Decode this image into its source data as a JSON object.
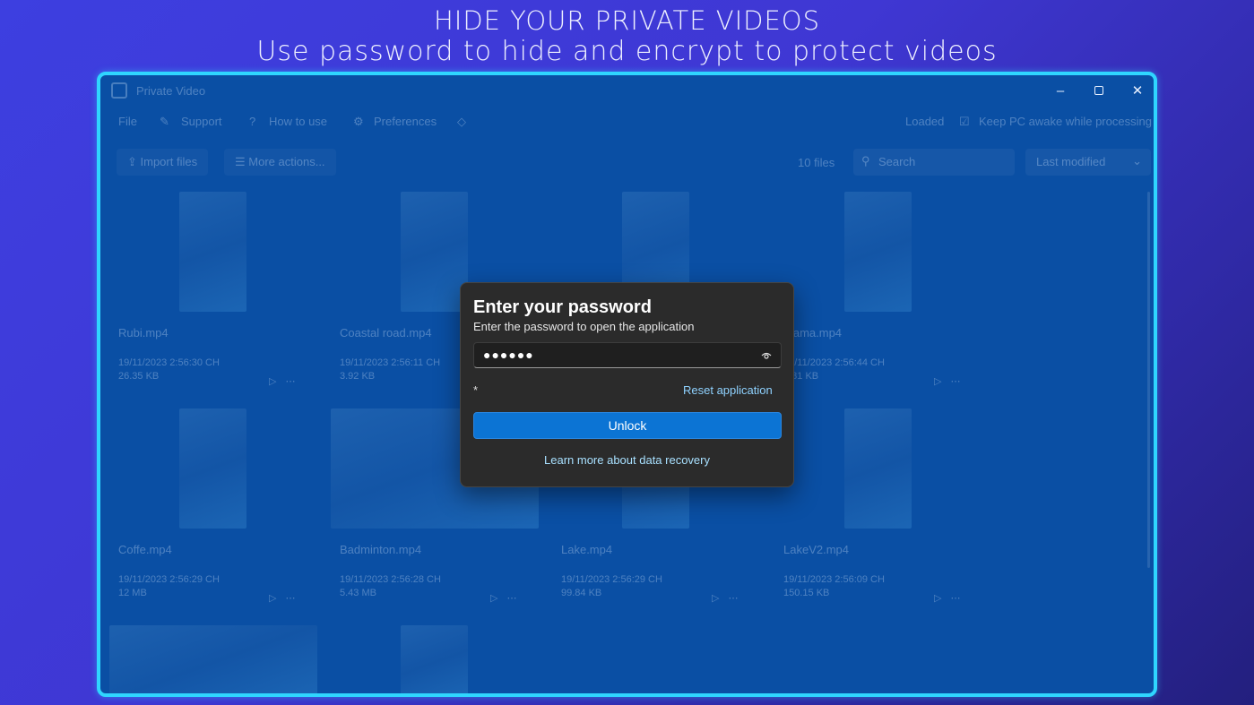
{
  "headline": {
    "line1": "HIDE YOUR PRIVATE VIDEOS",
    "line2": "Use password to hide and encrypt to protect videos"
  },
  "window": {
    "title": "Private Video",
    "icons": {
      "app": "calendar-app-icon",
      "minimize": "minimize-icon",
      "maximize": "maximize-icon",
      "close": "close-icon"
    },
    "menu": {
      "file": "File",
      "support": "Support",
      "how_to_use": "How to use",
      "preferences": "Preferences",
      "loaded": "Loaded",
      "keep_awake": "Keep PC awake while processing"
    },
    "toolbar": {
      "import": "Import files",
      "more": "More actions...",
      "count": "10 files",
      "search_placeholder": "Search",
      "sort": "Last modified"
    },
    "files": [
      {
        "name": "Rubi.mp4",
        "date": "19/11/2023 2:56:30 CH",
        "size": "26.35 KB"
      },
      {
        "name": "Coastal road.mp4",
        "date": "19/11/2023 2:56:11 CH",
        "size": "3.92 KB"
      },
      {
        "name": "",
        "date": "",
        "size": ""
      },
      {
        "name": "...ama.mp4",
        "date": "19/11/2023 2:56:44 CH",
        "size": "5.81 KB"
      },
      {
        "name": "Coffe.mp4",
        "date": "19/11/2023 2:56:29 CH",
        "size": "12 MB"
      },
      {
        "name": "Badminton.mp4",
        "date": "19/11/2023 2:56:28 CH",
        "size": "5.43 MB"
      },
      {
        "name": "Lake.mp4",
        "date": "19/11/2023 2:56:29 CH",
        "size": "99.84 KB"
      },
      {
        "name": "LakeV2.mp4",
        "date": "19/11/2023 2:56:09 CH",
        "size": "150.15 KB"
      }
    ]
  },
  "dialog": {
    "title": "Enter your password",
    "subtitle": "Enter the password to open the application",
    "password_value": "●●●●●●",
    "required_mark": "*",
    "reset_link": "Reset application",
    "unlock_label": "Unlock",
    "learn_link": "Learn more about data recovery",
    "colors": {
      "background": "#2b2b2b",
      "accent": "#0c74d4",
      "link": "#8fd2ff"
    }
  }
}
